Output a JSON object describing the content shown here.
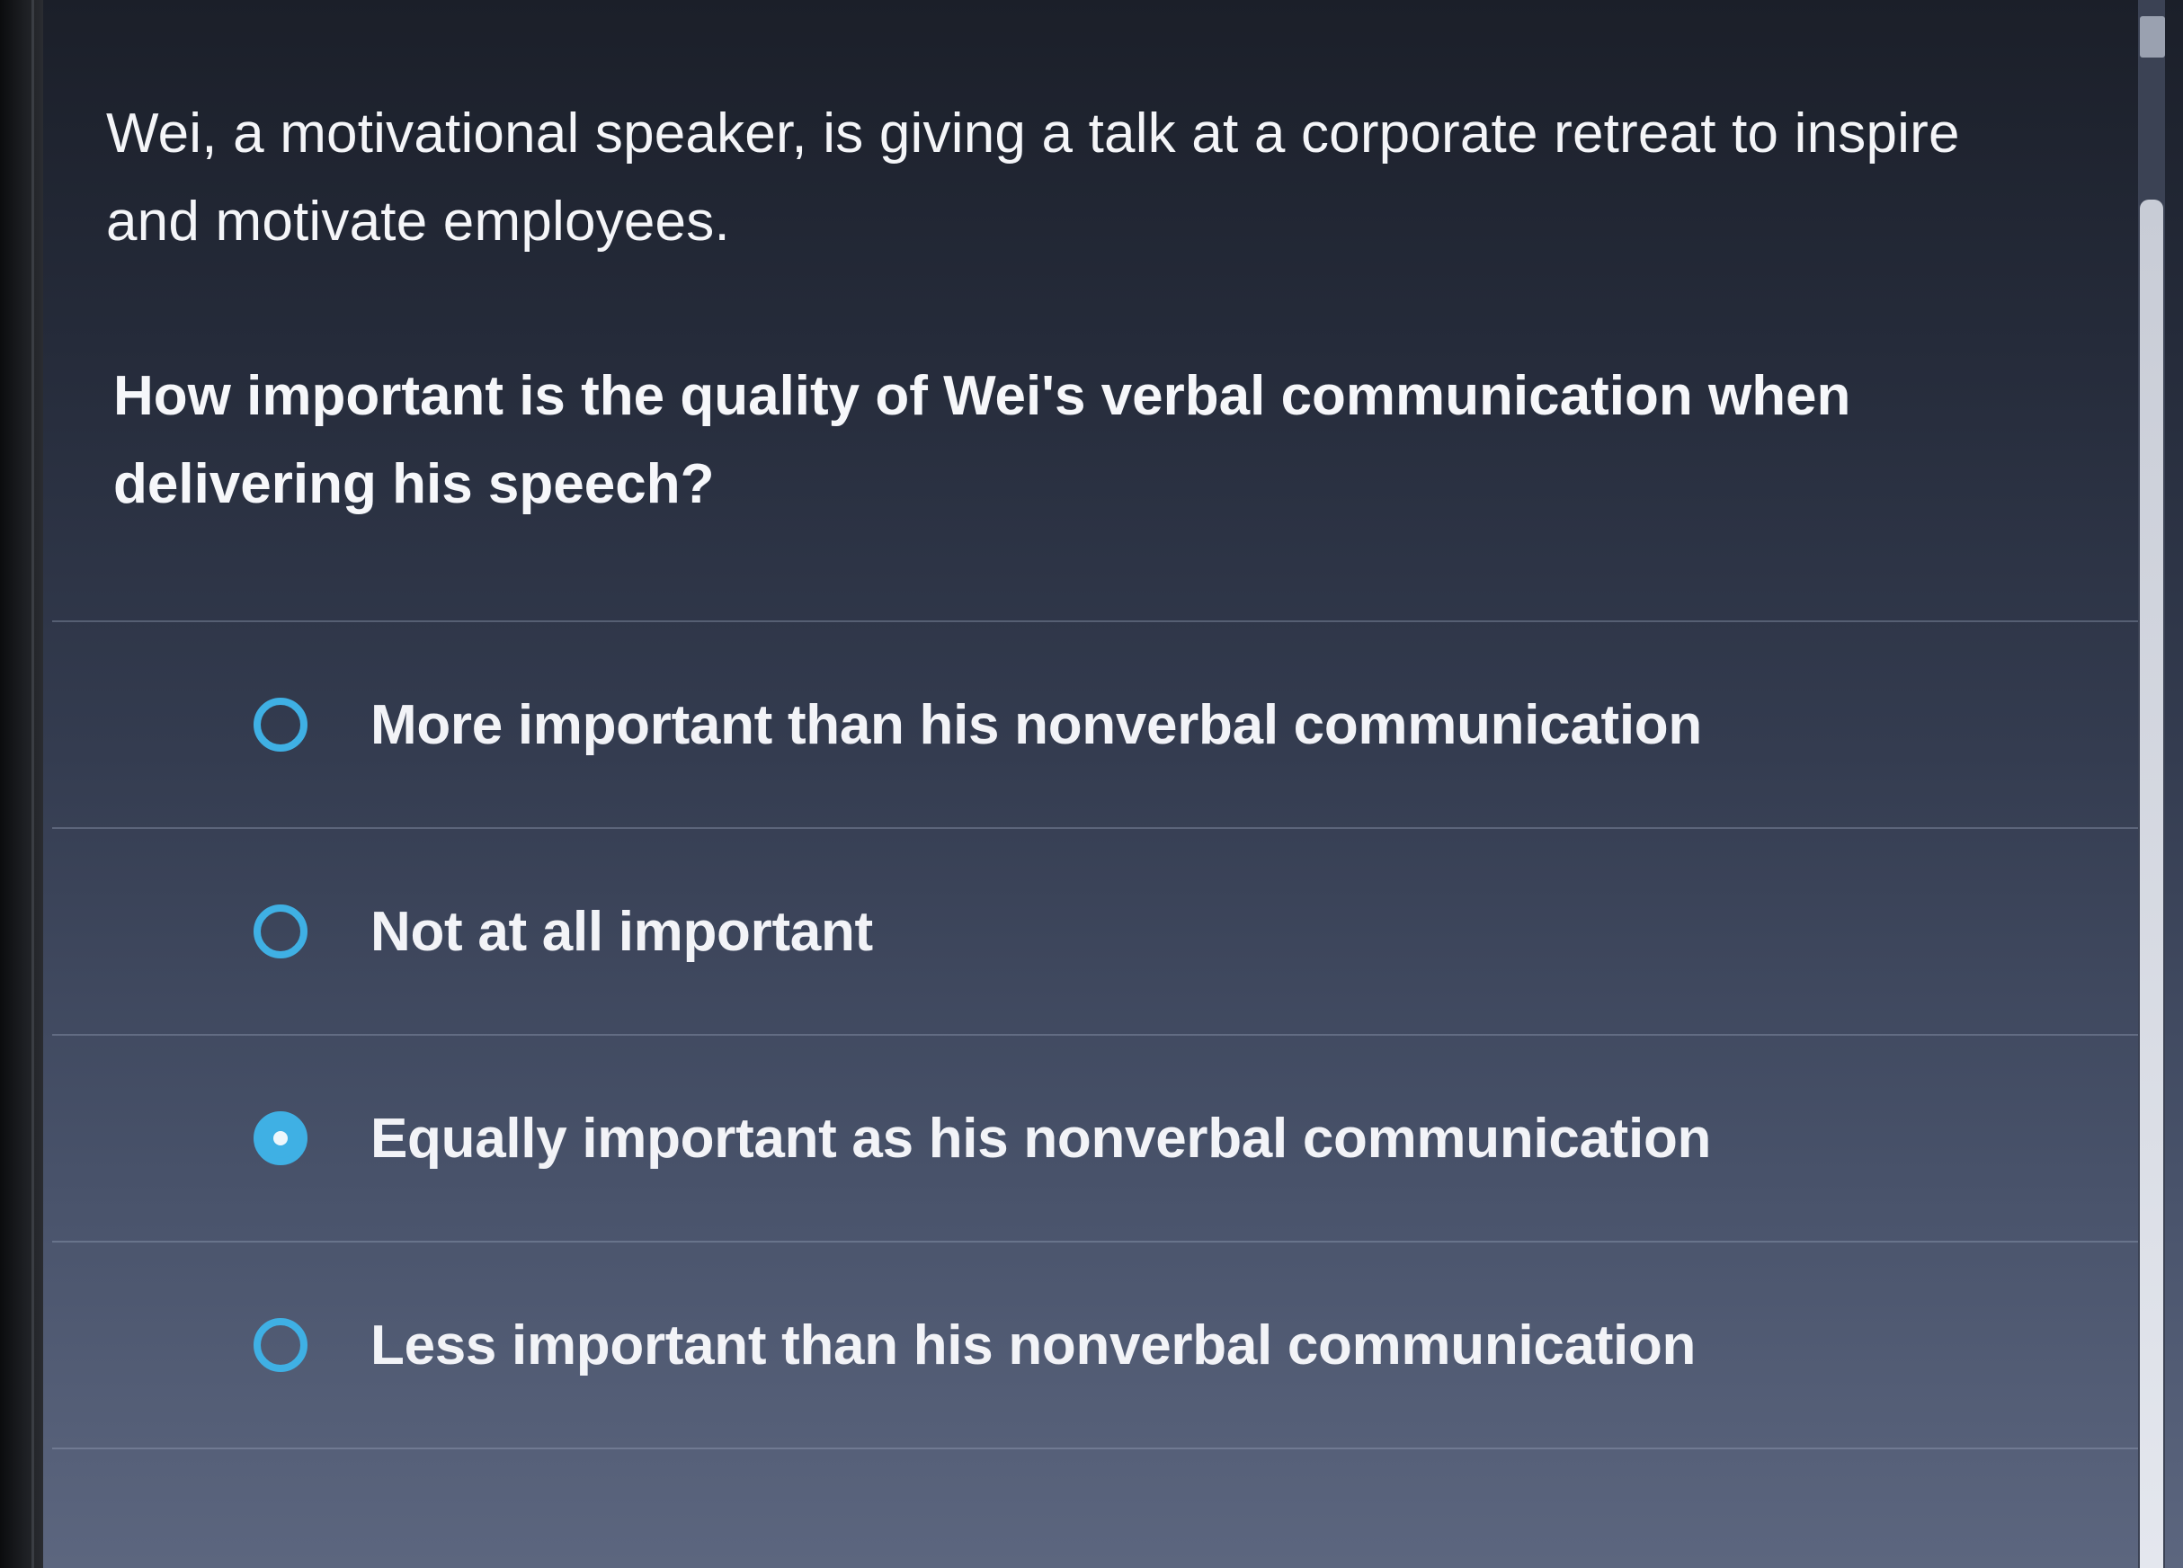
{
  "question": {
    "stem": "Wei, a motivational speaker, is giving a talk at a corporate retreat to inspire and motivate employees.",
    "prompt": "How important is the quality of Wei's verbal communication when delivering his speech?"
  },
  "options": [
    {
      "label": "More important than his nonverbal communication",
      "selected": false
    },
    {
      "label": "Not at all important",
      "selected": false
    },
    {
      "label": "Equally important as his nonverbal communication",
      "selected": true
    },
    {
      "label": "Less important than his nonverbal communication",
      "selected": false
    }
  ],
  "colors": {
    "accent": "#3fb0e4",
    "text": "#f2f3f7",
    "background_top": "#1b1f29",
    "background_bottom": "#5c667f"
  },
  "icons": {
    "radio_unselected": "radio-empty-icon",
    "radio_selected": "radio-checked-icon"
  }
}
